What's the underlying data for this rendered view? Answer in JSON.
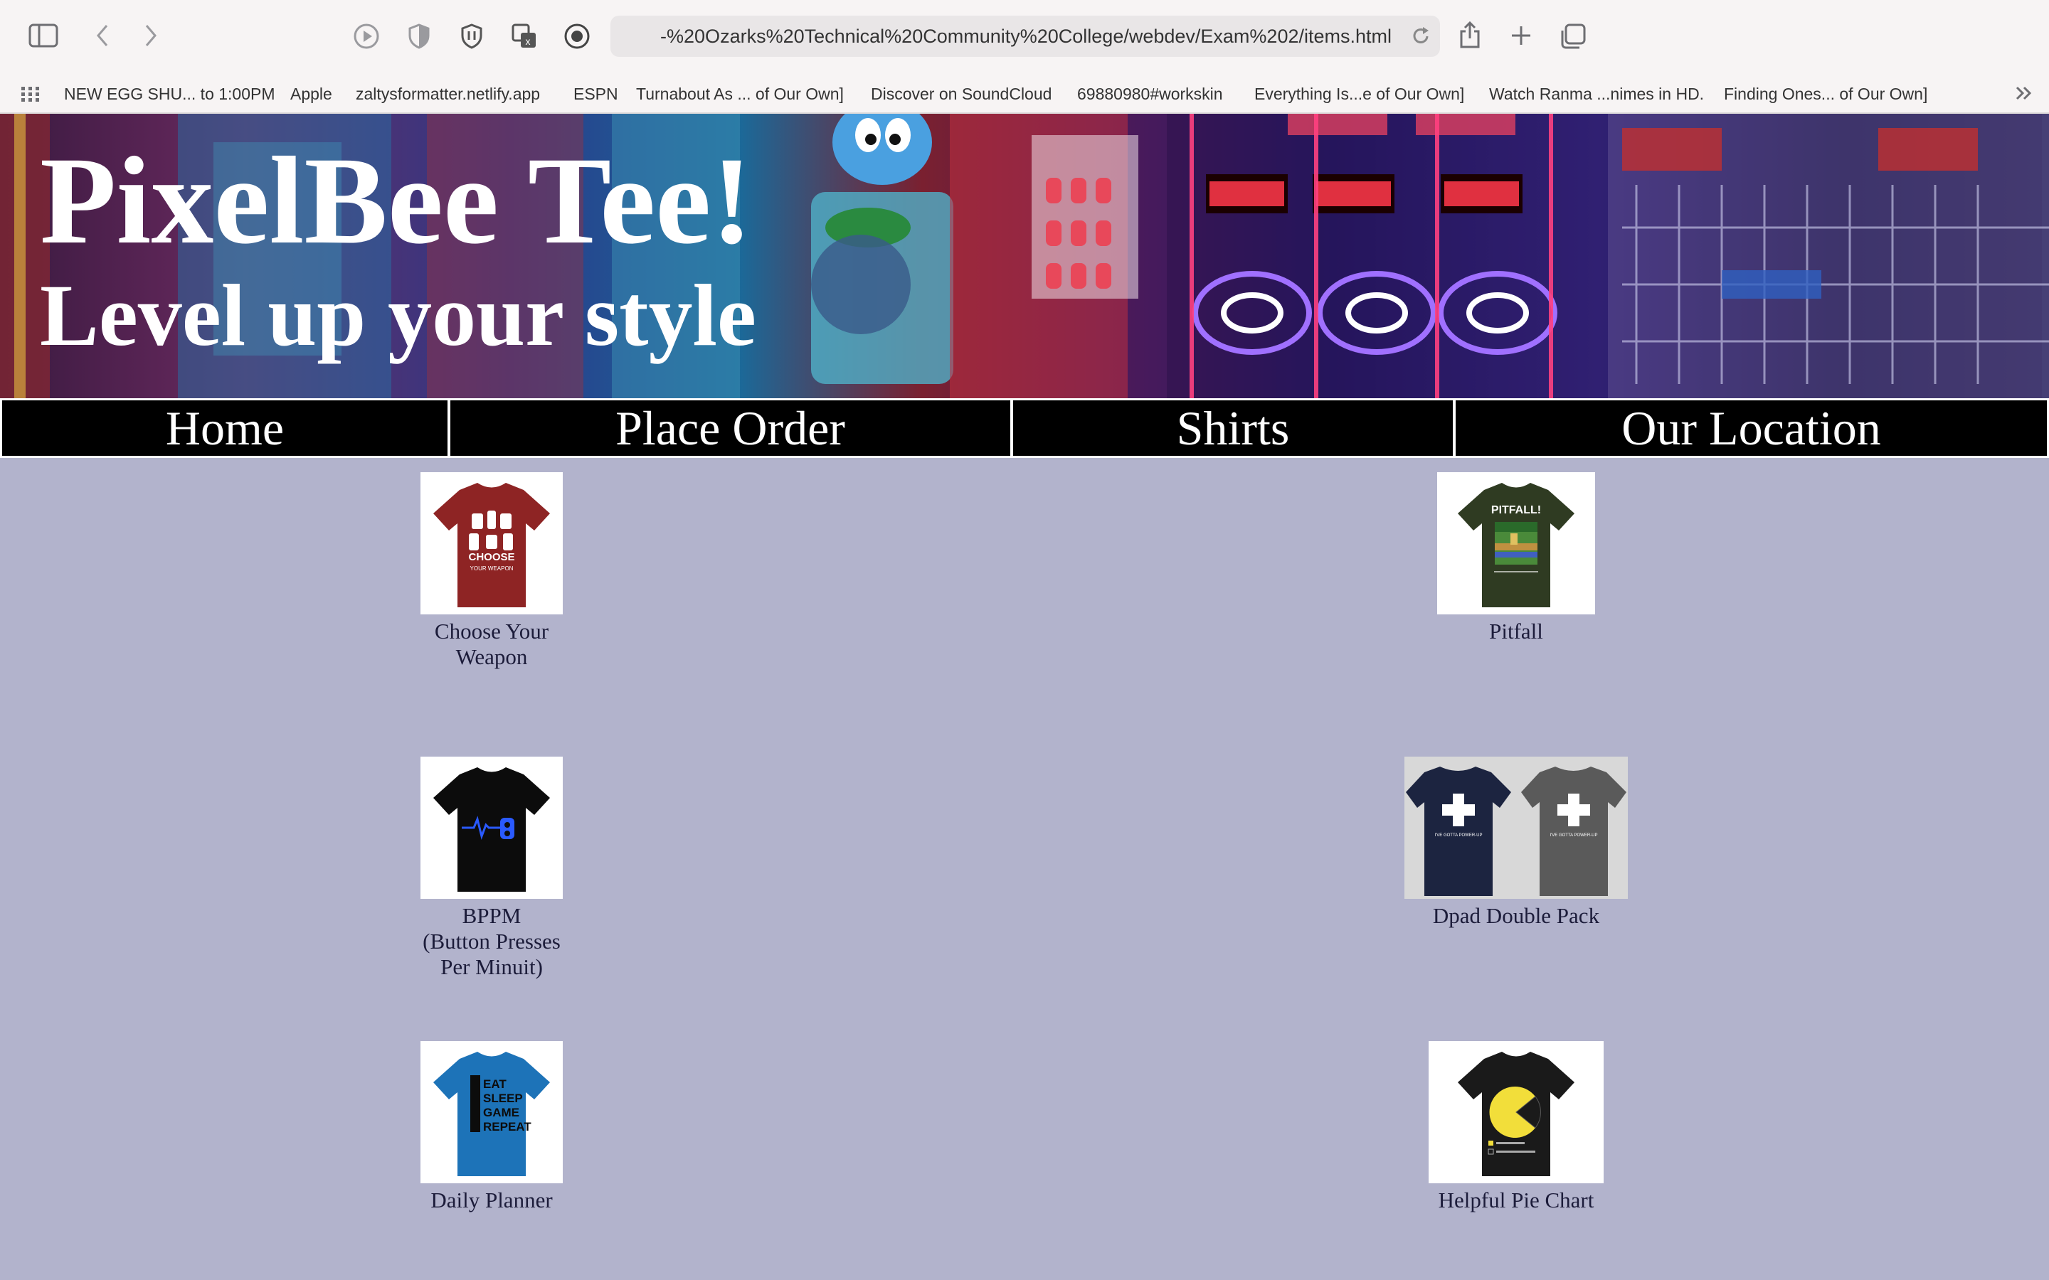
{
  "browser": {
    "url": "-%20Ozarks%20Technical%20Community%20College/webdev/Exam%202/items.html",
    "favorites": [
      "NEW EGG SHU... to 1:00PM",
      "Apple",
      "zaltysformatter.netlify.app",
      "ESPN",
      "Turnabout As ... of Our Own]",
      "Discover on SoundCloud",
      "69880980#workskin",
      "Everything Is...e of Our Own]",
      "Watch Ranma ...nimes in HD.",
      "Finding Ones... of Our Own]"
    ]
  },
  "header": {
    "title": "PixelBee Tee!",
    "tagline": "Level up your style"
  },
  "nav": [
    "Home",
    "Place Order",
    "Shirts",
    "Our Location"
  ],
  "products": [
    {
      "name": "Choose Your\nWeapon",
      "shirt_color": "#8e2424",
      "print": "CHOOSE\nYOUR WEAPON"
    },
    {
      "name": "Pitfall",
      "shirt_color": "#2f3b22",
      "print": "PITFALL!"
    },
    {
      "name": "BPPM\n(Button Presses\nPer Minuit)",
      "shirt_color": "#0c0c0c",
      "print": ""
    },
    {
      "name": "Dpad Double Pack",
      "shirt_color": "#1c2440",
      "print": "I'VE GOTTA POWER-UP"
    },
    {
      "name": "Daily Planner",
      "shirt_color": "#1d73b8",
      "print": "EAT\nSLEEP\nGAME\nREPEAT"
    },
    {
      "name": "Helpful Pie Chart",
      "shirt_color": "#1a1a1a",
      "print": ""
    }
  ],
  "colors": {
    "page_background": "#b2b3cc",
    "nav_background": "#000000",
    "nav_text": "#ffffff",
    "title_text": "#ffffff"
  }
}
